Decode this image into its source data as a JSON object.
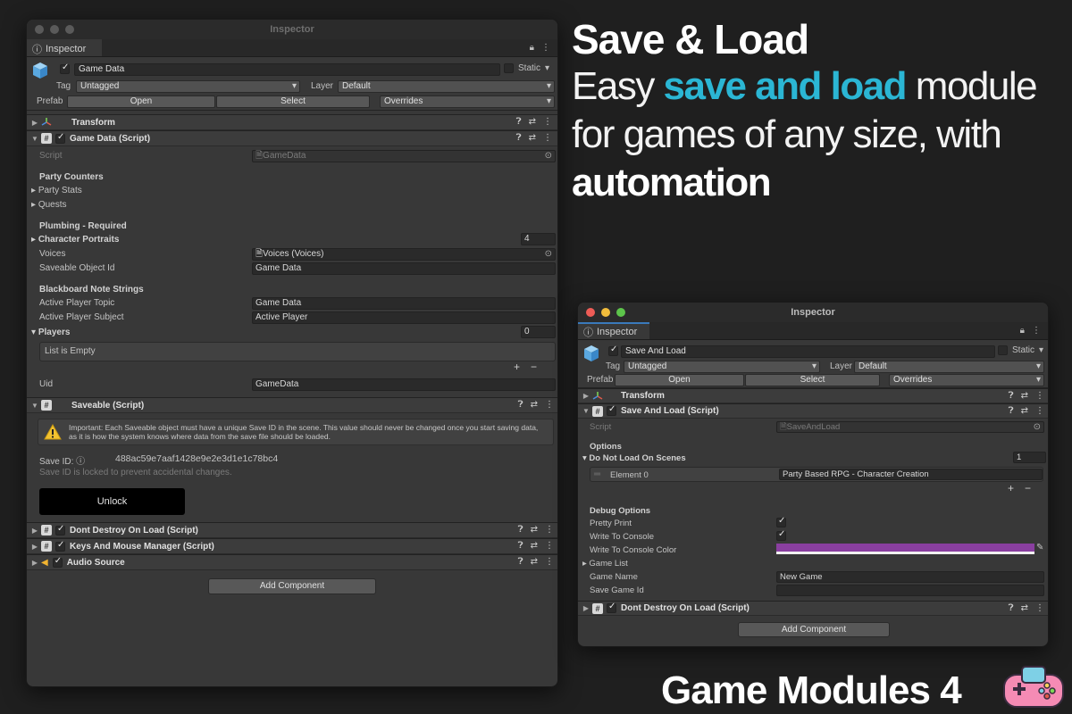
{
  "left_window": {
    "title": "Inspector",
    "tab_label": "Inspector",
    "object_name": "Game Data",
    "static_label": "Static",
    "tag_label": "Tag",
    "tag_value": "Untagged",
    "layer_label": "Layer",
    "layer_value": "Default",
    "prefab_label": "Prefab",
    "open_label": "Open",
    "select_label": "Select",
    "overrides_label": "Overrides",
    "components": {
      "transform": "Transform",
      "game_data": "Game Data (Script)",
      "saveable": "Saveable (Script)",
      "dont_destroy": "Dont Destroy On Load (Script)",
      "keys_mouse": "Keys And Mouse Manager (Script)",
      "audio_source": "Audio Source"
    },
    "script_label": "Script",
    "script_value": "GameData",
    "party_counters": "Party Counters",
    "party_stats": "Party Stats",
    "quests": "Quests",
    "plumbing": "Plumbing - Required",
    "character_portraits": "Character Portraits",
    "character_portraits_count": "4",
    "voices_label": "Voices",
    "voices_value": "Voices (Voices)",
    "saveable_id_label": "Saveable Object Id",
    "saveable_id_value": "Game Data",
    "blackboard": "Blackboard Note Strings",
    "active_topic_label": "Active Player Topic",
    "active_topic_value": "Game Data",
    "active_subject_label": "Active Player Subject",
    "active_subject_value": "Active Player",
    "players_label": "Players",
    "players_count": "0",
    "list_empty": "List is Empty",
    "uid_label": "Uid",
    "uid_value": "GameData",
    "warning_text": "Important: Each Saveable object must have a unique Save ID in the scene. This value should never be changed once you start saving data, as it is how the system knows where data from the save file should be loaded.",
    "save_id_label": "Save ID:",
    "save_id_value": "488ac59e7aaf1428e9e2e3d1e1c78bc4",
    "save_id_locked": "Save ID is locked to prevent accidental changes.",
    "unlock_label": "Unlock",
    "add_component": "Add Component"
  },
  "right_window": {
    "title": "Inspector",
    "tab_label": "Inspector",
    "object_name": "Save And Load",
    "static_label": "Static",
    "tag_label": "Tag",
    "tag_value": "Untagged",
    "layer_label": "Layer",
    "layer_value": "Default",
    "prefab_label": "Prefab",
    "open_label": "Open",
    "select_label": "Select",
    "overrides_label": "Overrides",
    "components": {
      "transform": "Transform",
      "save_and_load": "Save And Load (Script)",
      "dont_destroy": "Dont Destroy On Load (Script)"
    },
    "script_label": "Script",
    "script_value": "SaveAndLoad",
    "options": "Options",
    "do_not_load": "Do Not Load On Scenes",
    "do_not_load_count": "1",
    "element0_label": "Element 0",
    "element0_value": "Party Based RPG - Character Creation",
    "debug_options": "Debug Options",
    "pretty_print": "Pretty Print",
    "write_console": "Write To Console",
    "write_console_color": "Write To Console Color",
    "console_color": "#8a3fa0",
    "game_list": "Game List",
    "game_name_label": "Game Name",
    "game_name_value": "New Game",
    "save_game_id_label": "Save Game Id",
    "save_game_id_value": "",
    "add_component": "Add Component"
  },
  "headline": {
    "title": "Save & Load",
    "line1_pre": "Easy ",
    "line1_accent": "save and load",
    "line1_post": " module",
    "line2": "for games of any size, with",
    "line3": "automation",
    "accent_color": "#2bb6d4"
  },
  "brand": "Game Modules 4"
}
